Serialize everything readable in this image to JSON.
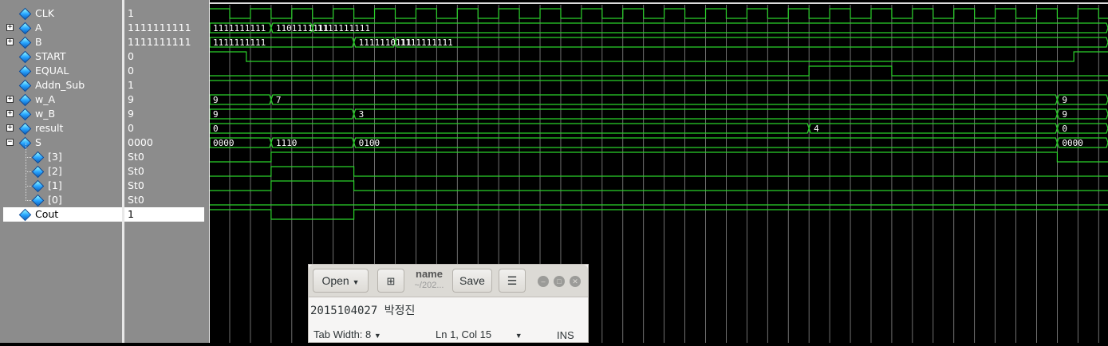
{
  "colors": {
    "wave": "#2bd22b",
    "grid": "#8a8a8a",
    "bg": "#000000",
    "panel": "#8c8c8c"
  },
  "signals": [
    {
      "name": "CLK",
      "value": "1",
      "type": "clock",
      "expandable": false,
      "level": 0
    },
    {
      "name": "A",
      "value": "1111111111",
      "type": "bus",
      "expandable": true,
      "level": 0,
      "segments": [
        {
          "from": 0,
          "label": "1111111111"
        },
        {
          "from": 1,
          "label": "1101111111"
        },
        {
          "from": 2,
          "label": "1111111111"
        }
      ]
    },
    {
      "name": "B",
      "value": "1111111111",
      "type": "bus",
      "expandable": true,
      "level": 0,
      "segments": [
        {
          "from": 0,
          "label": "1111111111"
        },
        {
          "from": 3,
          "label": "1111110111"
        },
        {
          "from": 4,
          "label": "1111111111"
        }
      ]
    },
    {
      "name": "START",
      "value": "0",
      "type": "bit",
      "expandable": false,
      "level": 0,
      "levels": [
        [
          0,
          0.4,
          1
        ],
        [
          0.4,
          20.4,
          0
        ],
        [
          20.4,
          21.7,
          1
        ]
      ]
    },
    {
      "name": "EQUAL",
      "value": "0",
      "type": "bit",
      "expandable": false,
      "level": 0,
      "levels": [
        [
          0,
          14,
          0
        ],
        [
          14,
          16,
          1
        ],
        [
          16,
          21.7,
          0
        ]
      ]
    },
    {
      "name": "Addn_Sub",
      "value": "1",
      "type": "bit",
      "expandable": false,
      "level": 0,
      "levels": [
        [
          0,
          21.7,
          1
        ]
      ]
    },
    {
      "name": "w_A",
      "value": "9",
      "type": "bus",
      "expandable": true,
      "level": 0,
      "segments": [
        {
          "from": 0,
          "label": "9"
        },
        {
          "from": 1,
          "label": "7"
        },
        {
          "from": 20,
          "label": "9"
        }
      ]
    },
    {
      "name": "w_B",
      "value": "9",
      "type": "bus",
      "expandable": true,
      "level": 0,
      "segments": [
        {
          "from": 0,
          "label": "9"
        },
        {
          "from": 3,
          "label": "3"
        },
        {
          "from": 20,
          "label": "9"
        }
      ]
    },
    {
      "name": "result",
      "value": "0",
      "type": "bus",
      "expandable": true,
      "level": 0,
      "segments": [
        {
          "from": 0,
          "label": "0"
        },
        {
          "from": 14,
          "label": "4"
        },
        {
          "from": 20,
          "label": "0"
        }
      ]
    },
    {
      "name": "S",
      "value": "0000",
      "type": "bus",
      "expandable": true,
      "expanded": true,
      "level": 0,
      "segments": [
        {
          "from": 0,
          "label": "0000"
        },
        {
          "from": 1,
          "label": "1110"
        },
        {
          "from": 3,
          "label": "0100"
        },
        {
          "from": 20,
          "label": "0000"
        }
      ]
    },
    {
      "name": "[3]",
      "value": "St0",
      "type": "bit",
      "expandable": false,
      "level": 1,
      "levels": [
        [
          0,
          1,
          0
        ],
        [
          1,
          3,
          1
        ],
        [
          3,
          20,
          1
        ],
        [
          20,
          21.7,
          0
        ]
      ]
    },
    {
      "name": "[2]",
      "value": "St0",
      "type": "bit",
      "expandable": false,
      "level": 1,
      "levels": [
        [
          0,
          1,
          0
        ],
        [
          1,
          3,
          1
        ],
        [
          3,
          20,
          0
        ],
        [
          20,
          21.7,
          0
        ]
      ]
    },
    {
      "name": "[1]",
      "value": "St0",
      "type": "bit",
      "expandable": false,
      "level": 1,
      "levels": [
        [
          0,
          1,
          0
        ],
        [
          1,
          3,
          1
        ],
        [
          3,
          20,
          0
        ],
        [
          20,
          21.7,
          0
        ]
      ]
    },
    {
      "name": "[0]",
      "value": "St0",
      "type": "bit",
      "expandable": false,
      "level": 1,
      "levels": [
        [
          0,
          21.7,
          0
        ]
      ]
    },
    {
      "name": "Cout",
      "value": "1",
      "type": "bit",
      "expandable": false,
      "level": 0,
      "selected": true,
      "levels": [
        [
          0,
          1,
          1
        ],
        [
          1,
          3,
          0
        ],
        [
          3,
          21.7,
          1
        ]
      ]
    }
  ],
  "editor": {
    "open_label": "Open",
    "doc_name": "name",
    "doc_path": "~/202...",
    "save_label": "Save",
    "content": "2015104027 박정진",
    "tab_width": "Tab Width: 8",
    "cursor_pos": "Ln 1, Col 15",
    "ins": "INS"
  }
}
